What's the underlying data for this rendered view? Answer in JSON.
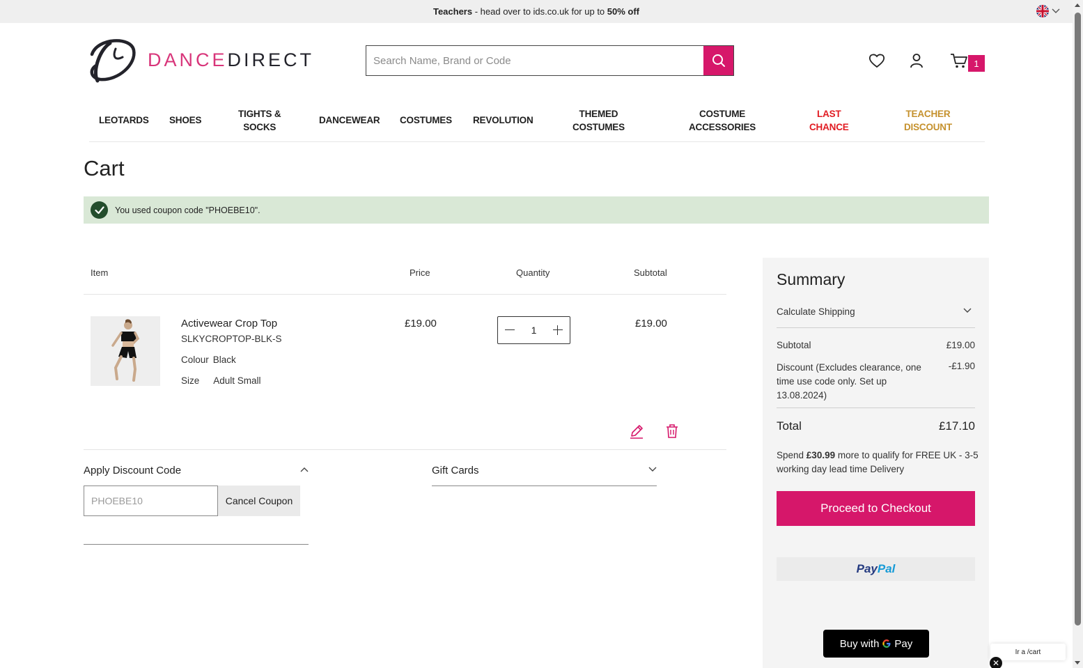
{
  "banner": {
    "lead": "Teachers",
    "middle": " - head over to ids.co.uk for up to ",
    "highlight": "50% off"
  },
  "header": {
    "logo_part1": "DANCE",
    "logo_part2": "DIRECT",
    "search_placeholder": "Search Name, Brand or Code",
    "cart_count": "1",
    "brand_color": "#d6176a"
  },
  "nav": {
    "items": [
      {
        "label": "LEOTARDS"
      },
      {
        "label": "SHOES"
      },
      {
        "label": "TIGHTS &\nSOCKS"
      },
      {
        "label": "DANCEWEAR"
      },
      {
        "label": "COSTUMES"
      },
      {
        "label": "REVOLUTION"
      },
      {
        "label": "THEMED\nCOSTUMES"
      },
      {
        "label": "COSTUME\nACCESSORIES"
      },
      {
        "label": "LAST\nCHANCE"
      },
      {
        "label": "TEACHER\nDISCOUNT"
      }
    ]
  },
  "page": {
    "title": "Cart",
    "notice": "You used coupon code \"PHOEBE10\"."
  },
  "table": {
    "headers": {
      "item": "Item",
      "price": "Price",
      "quantity": "Quantity",
      "subtotal": "Subtotal"
    },
    "row": {
      "name": "Activewear Crop Top",
      "sku": "SLKYCROPTOP-BLK-S",
      "colour_label": "Colour",
      "colour_value": "Black",
      "size_label": "Size",
      "size_value": "Adult Small",
      "price": "£19.00",
      "quantity": "1",
      "subtotal": "£19.00"
    }
  },
  "discount": {
    "title": "Apply Discount Code",
    "input_value": "PHOEBE10",
    "cancel_label": "Cancel Coupon"
  },
  "giftcards": {
    "title": "Gift Cards"
  },
  "summary": {
    "title": "Summary",
    "shipping_label": "Calculate Shipping",
    "subtotal_label": "Subtotal",
    "subtotal_value": "£19.00",
    "discount_label": "Discount (Excludes clearance, one time use code only. Set up 13.08.2024)",
    "discount_value": "-£1.90",
    "total_label": "Total",
    "total_value": "£17.10",
    "spend_prefix": "Spend ",
    "spend_amount": "£30.99",
    "spend_suffix": " more to qualify for FREE UK - 3-5 working day lead time Delivery",
    "checkout_label": "Proceed to Checkout",
    "paypal_part1": "Pay",
    "paypal_part2": "Pal",
    "gpay_prefix": "Buy with",
    "gpay_brand": "Pay"
  },
  "widget": {
    "text": "Ir a /cart",
    "close": "✕"
  }
}
